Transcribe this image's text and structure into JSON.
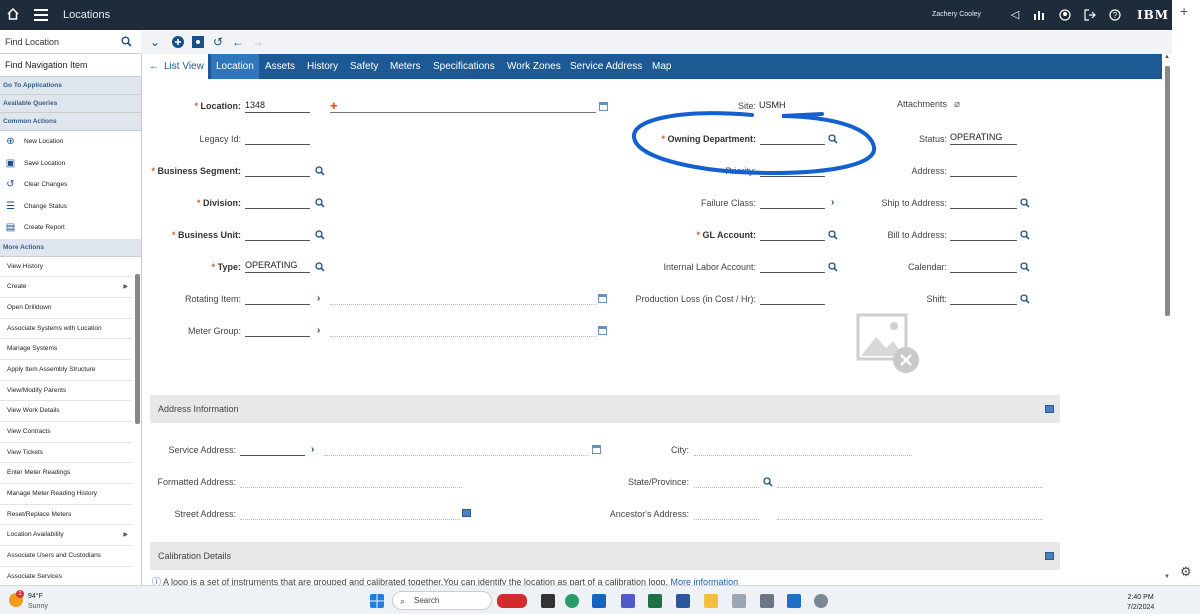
{
  "header": {
    "title": "Locations",
    "user": "Zachery Cooley",
    "brand": "IBM"
  },
  "find_location": {
    "label": "Find Location"
  },
  "sidebar": {
    "nav_title": "Find Navigation Item",
    "sections": {
      "go_to": "Go To Applications",
      "queries": "Available Queries",
      "common": "Common Actions",
      "more": "More Actions"
    },
    "common_actions": [
      "New Location",
      "Save Location",
      "Clear Changes",
      "Change Status",
      "Create Report"
    ],
    "more_actions": [
      "View History",
      "Create",
      "Open Drilldown",
      "Associate Systems with Location",
      "Manage Systems",
      "Apply Item Assembly Structure",
      "View/Modify Parents",
      "View Work Details",
      "View Contracts",
      "View Tickets",
      "Enter Meter Readings",
      "Manage Meter Reading History",
      "Reset/Replace Meters",
      "Location Availability",
      "Associate Users and Custodians",
      "Associate Services"
    ]
  },
  "tabs": [
    "List View",
    "Location",
    "Assets",
    "History",
    "Safety",
    "Meters",
    "Specifications",
    "Work Zones",
    "Service Address",
    "Map"
  ],
  "form": {
    "location": {
      "label": "Location:",
      "value": "1348"
    },
    "legacy_id": {
      "label": "Legacy Id:"
    },
    "business_segment": {
      "label": "Business Segment:"
    },
    "division": {
      "label": "Division:"
    },
    "business_unit": {
      "label": "Business Unit:"
    },
    "type": {
      "label": "Type:",
      "value": "OPERATING"
    },
    "rotating_item": {
      "label": "Rotating Item:"
    },
    "meter_group": {
      "label": "Meter Group:"
    },
    "site": {
      "label": "Site:",
      "value": "USMH"
    },
    "owning_department": {
      "label": "Owning Department:"
    },
    "priority": {
      "label": "Priority:"
    },
    "failure_class": {
      "label": "Failure Class:"
    },
    "gl_account": {
      "label": "GL Account:"
    },
    "internal_labor_account": {
      "label": "Internal Labor Account:"
    },
    "production_loss": {
      "label": "Production Loss (in Cost / Hr):"
    },
    "attachments": {
      "label": "Attachments"
    },
    "status": {
      "label": "Status:",
      "value": "OPERATING"
    },
    "address": {
      "label": "Address:"
    },
    "ship_to": {
      "label": "Ship to Address:"
    },
    "bill_to": {
      "label": "Bill to Address:"
    },
    "calendar": {
      "label": "Calendar:"
    },
    "shift": {
      "label": "Shift:"
    }
  },
  "address_section": {
    "title": "Address Information",
    "service_address": "Service Address:",
    "formatted_address": "Formatted Address:",
    "street_address": "Street Address:",
    "city": "City:",
    "state": "State/Province:",
    "ancestor": "Ancestor's Address:"
  },
  "calibration": {
    "title": "Calibration Details",
    "note": "A loop is a set of instruments that are grouped and calibrated together.You can identify the location as part of a calibration loop.",
    "more_link": "More information"
  },
  "taskbar": {
    "temp": "94°F",
    "weather": "Sunny",
    "weather_badge": "1",
    "search": "Search",
    "time": "2:40 PM",
    "date": "7/2/2024"
  },
  "colors": {
    "header": "#1d2b3a",
    "tab_bar": "#1d5a95",
    "active_tab": "#2f76bd",
    "required": "#e05c20",
    "annotation": "#1560d1"
  }
}
